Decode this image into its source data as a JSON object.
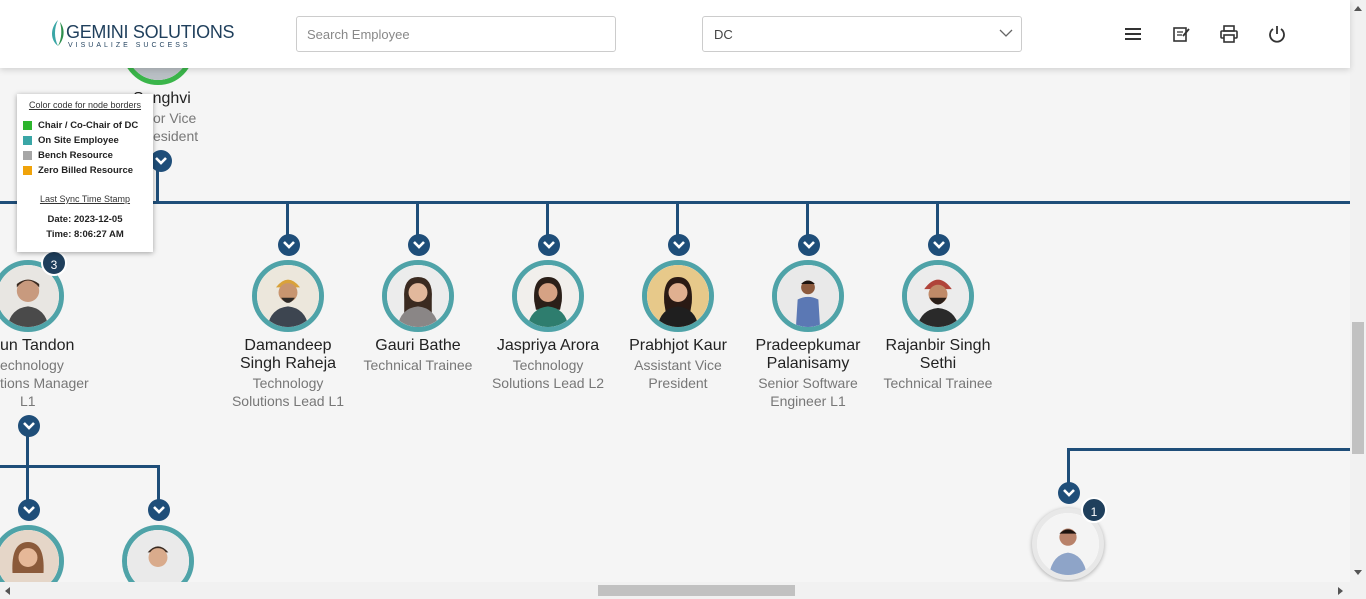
{
  "header": {
    "logo_title": "GEMINI SOLUTIONS",
    "logo_tagline": "VISUALIZE SUCCESS",
    "search_placeholder": "Search Employee",
    "dc_selected": "DC",
    "icons": [
      "menu-icon",
      "notes-icon",
      "print-icon",
      "power-icon"
    ]
  },
  "legend": {
    "heading": "Color code for node borders",
    "items": [
      {
        "label": "Chair / Co-Chair of DC",
        "color": "#2db52d"
      },
      {
        "label": "On Site Employee",
        "color": "#3aa6a6"
      },
      {
        "label": "Bench Resource",
        "color": "#a6a6a6"
      },
      {
        "label": "Zero Billed Resource",
        "color": "#f0a30a"
      }
    ],
    "sync_heading": "Last Sync Time Stamp",
    "date_label": "Date: 2023-12-05",
    "time_label": "Time: 8:06:27 AM"
  },
  "top_node": {
    "name_fragment": "Sanghvi",
    "title_line1": "or Vice",
    "title_line2": "esident"
  },
  "left_node": {
    "name": "un Tandon",
    "title": "echnology",
    "title2": "tions Manager",
    "title3": "L1",
    "badge": "3"
  },
  "employees": [
    {
      "name": "Damandeep Singh Raheja",
      "title": "Technology Solutions Lead L1"
    },
    {
      "name": "Gauri Bathe",
      "title": "Technical Trainee"
    },
    {
      "name": "Jaspriya Arora",
      "title": "Technology Solutions Lead L2"
    },
    {
      "name": "Prabhjot Kaur",
      "title": "Assistant Vice President"
    },
    {
      "name": "Pradeepkumar Palanisamy",
      "title": "Senior Software Engineer L1"
    },
    {
      "name": "Rajanbir Singh Sethi",
      "title": "Technical Trainee"
    }
  ],
  "right_node": {
    "badge": "1"
  },
  "colors": {
    "accent": "#1f4e79",
    "onsite": "#4fa3a8"
  }
}
